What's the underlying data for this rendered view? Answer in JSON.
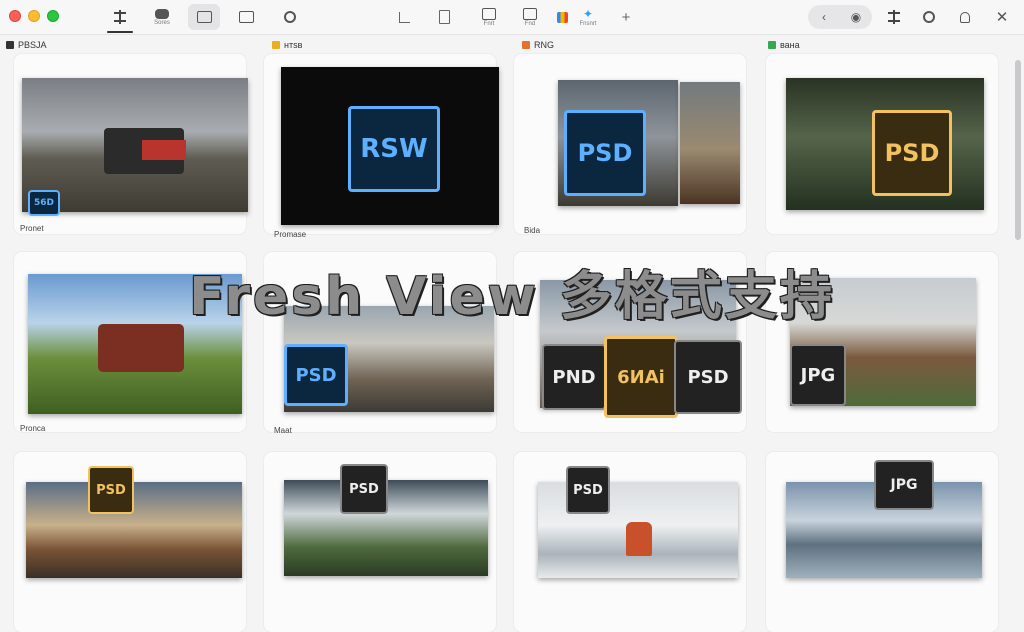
{
  "toolbar": {
    "tab_labels": [
      "",
      "Sores",
      "",
      "",
      ""
    ],
    "right_labels": [
      "",
      "",
      "Fnrt",
      "Fnd",
      "",
      "Fnsnrt",
      ""
    ],
    "add": "+"
  },
  "columns": [
    {
      "label": "PBSJA",
      "color": "#333333"
    },
    {
      "label": "нтsв",
      "color": "#e8b021"
    },
    {
      "label": "RNG",
      "color": "#e6702d"
    },
    {
      "label": "вана",
      "color": "#36a852"
    }
  ],
  "cards": [
    {
      "caption": "Pronet",
      "badge": "56D",
      "badge_style": "blue"
    },
    {
      "caption": "Promase",
      "badge": "RSW",
      "badge_style": "blue"
    },
    {
      "caption": "Bida",
      "badge": "PSD",
      "badge_style": "blue"
    },
    {
      "caption": "",
      "badge": "PSD",
      "badge_style": "gold"
    },
    {
      "caption": "Pronca",
      "badge": "",
      "badge_style": "blue"
    },
    {
      "caption": "Maat",
      "badge": "PSD",
      "badge_style": "blue"
    },
    {
      "caption": "",
      "badges": [
        "PND",
        "6ИAi",
        "PSD"
      ]
    },
    {
      "caption": "",
      "badge": "JPG",
      "badge_style": "dark"
    },
    {
      "caption": "",
      "badge": "PSD",
      "badge_style": "gold"
    },
    {
      "caption": "",
      "badge": "PSD",
      "badge_style": "dark"
    },
    {
      "caption": "",
      "badge": "PSD",
      "badge_style": "dark"
    },
    {
      "caption": "",
      "badge": "JPG",
      "badge_style": "dark"
    }
  ],
  "overlay": {
    "title": "Fresh View 多格式支持"
  }
}
